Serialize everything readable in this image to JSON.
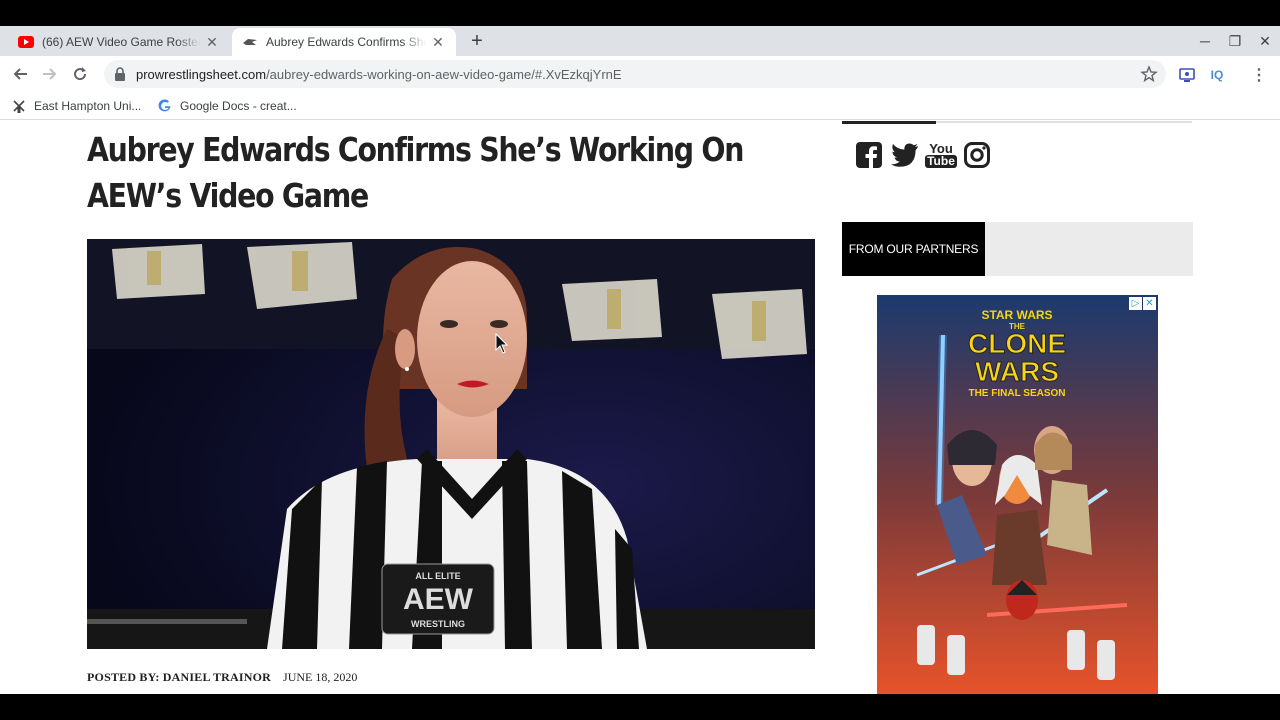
{
  "tabs": [
    {
      "title": "(66) AEW Video Game Roster Me",
      "favicon": "youtube-icon",
      "active": false
    },
    {
      "title": "Aubrey Edwards Confirms She's",
      "favicon": "pws-site-icon",
      "active": true
    }
  ],
  "address": {
    "host": "prowrestlingsheet.com",
    "path": "/aubrey-edwards-working-on-aew-video-game/#.XvEzkqjYrnE"
  },
  "toolbar": {
    "ext_iq": "IQ"
  },
  "bookmarks": [
    {
      "label": "East Hampton Uni...",
      "icon": "windmill-icon"
    },
    {
      "label": "Google Docs - creat...",
      "icon": "google-icon"
    }
  ],
  "article": {
    "title": "Aubrey Edwards Confirms She’s Working On AEW’s Video Game",
    "posted_by": "POSTED BY: DANIEL TRAINOR",
    "date": "JUNE 18, 2020",
    "image_badge": {
      "line1": "ALL ELITE",
      "line2": "AEW",
      "line3": "WRESTLING"
    }
  },
  "sidebar": {
    "social": [
      "facebook-icon",
      "twitter-icon",
      "youtube-icon",
      "instagram-icon"
    ],
    "youtube_text": {
      "line1": "You",
      "line2": "Tube"
    },
    "partners_label": "FROM OUR PARTNERS"
  },
  "ad": {
    "line1": "STAR WARS",
    "line2": "THE",
    "line3": "CLONE",
    "line4": "WARS",
    "line5": "THE FINAL SEASON"
  },
  "colors": {
    "tabstrip": "#dee1e6",
    "omnibox": "#f1f3f4",
    "youtube_red": "#ff0000",
    "partners_bg": "#000000",
    "ad_yellow": "#f7d416"
  }
}
